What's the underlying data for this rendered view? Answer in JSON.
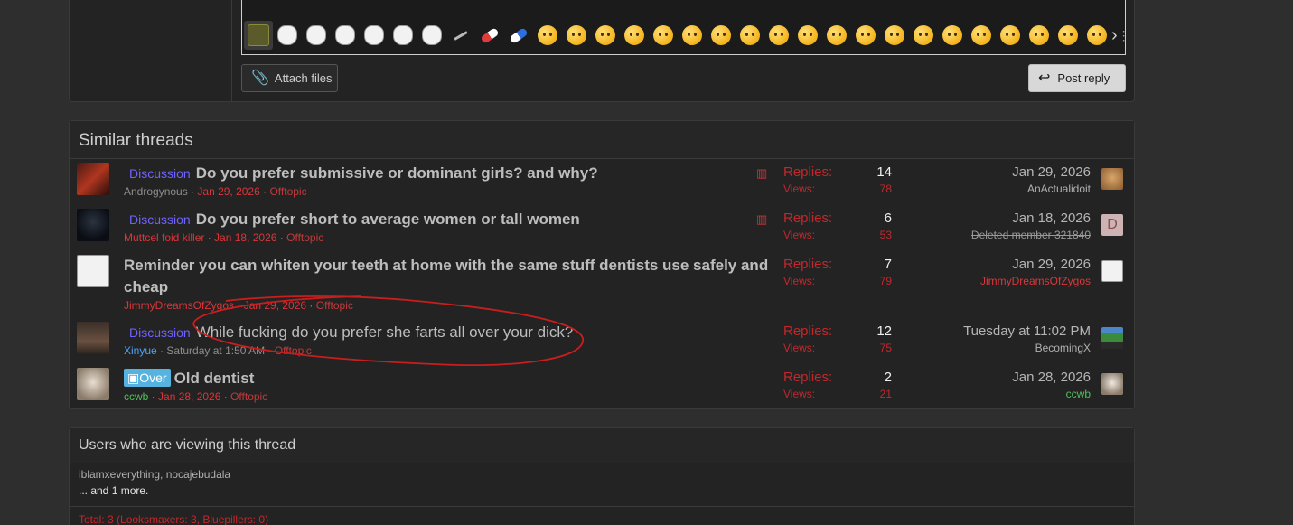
{
  "reply": {
    "attach_label": "Attach files",
    "post_label": "Post reply",
    "smilies": [
      "green-face",
      "meme-face",
      "meme-face",
      "meme-face",
      "meme-face",
      "meme-face",
      "meme-face",
      "needle",
      "pill-red",
      "pill-blue",
      "emoji-face",
      "emoji-face",
      "emoji-face",
      "emoji-face",
      "emoji-face",
      "emoji-face",
      "emoji-face",
      "emoji-face",
      "emoji-face",
      "emoji-face",
      "emoji-face",
      "emoji-face",
      "emoji-face",
      "emoji-face",
      "emoji-face",
      "emoji-face",
      "emoji-face",
      "emoji-face",
      "emoji-face",
      "emoji-face"
    ]
  },
  "similar": {
    "title": "Similar threads",
    "replies_label": "Replies:",
    "views_label": "Views:",
    "threads": [
      {
        "prefix": "Discussion",
        "title": "Do you prefer submissive or dominant girls? and why?",
        "author": "Androgynous",
        "date": "Jan 29, 2026",
        "forum": "Offtopic",
        "replies": "14",
        "views": "78",
        "last_date": "Jan 29, 2026",
        "last_user": "AnActualidoit",
        "poll": true
      },
      {
        "prefix": "Discussion",
        "title": "Do you prefer short to average women or tall women",
        "author": "Muttcel foid killer",
        "date": "Jan 18, 2026",
        "forum": "Offtopic",
        "replies": "6",
        "views": "53",
        "last_date": "Jan 18, 2026",
        "last_user": "Deleted member 321840",
        "last_avatar_letter": "D",
        "poll": true
      },
      {
        "prefix": "",
        "title": "Reminder you can whiten your teeth at home with the same stuff dentists use safely and cheap",
        "author": "JimmyDreamsOfZygos",
        "date": "Jan 29, 2026",
        "forum": "Offtopic",
        "replies": "7",
        "views": "79",
        "last_date": "Jan 29, 2026",
        "last_user": "JimmyDreamsOfZygos"
      },
      {
        "prefix": "Discussion",
        "title": "While fucking do you prefer she farts all over your dick?",
        "author": "Xinyue",
        "date": "Saturday at 1:50 AM",
        "forum": "Offtopic",
        "replies": "12",
        "views": "75",
        "last_date": "Tuesday at 11:02 PM",
        "last_user": "BecomingX"
      },
      {
        "prefix": "Over",
        "title": "Old dentist",
        "author": "ccwb",
        "date": "Jan 28, 2026",
        "forum": "Offtopic",
        "replies": "2",
        "views": "21",
        "last_date": "Jan 28, 2026",
        "last_user": "ccwb"
      }
    ]
  },
  "viewing": {
    "title": "Users who are viewing this thread",
    "names": "iblamxeverything, nocajebudala",
    "more": "... and 1 more.",
    "total": "Total: 3 (Looksmaxers: 3, Bluepillers: 0)"
  },
  "colors": {
    "accent_red": "#c3272b",
    "prefix_purple": "#6f63ff",
    "over_blue": "#56b3e0",
    "scribble": "#c81e1e"
  }
}
